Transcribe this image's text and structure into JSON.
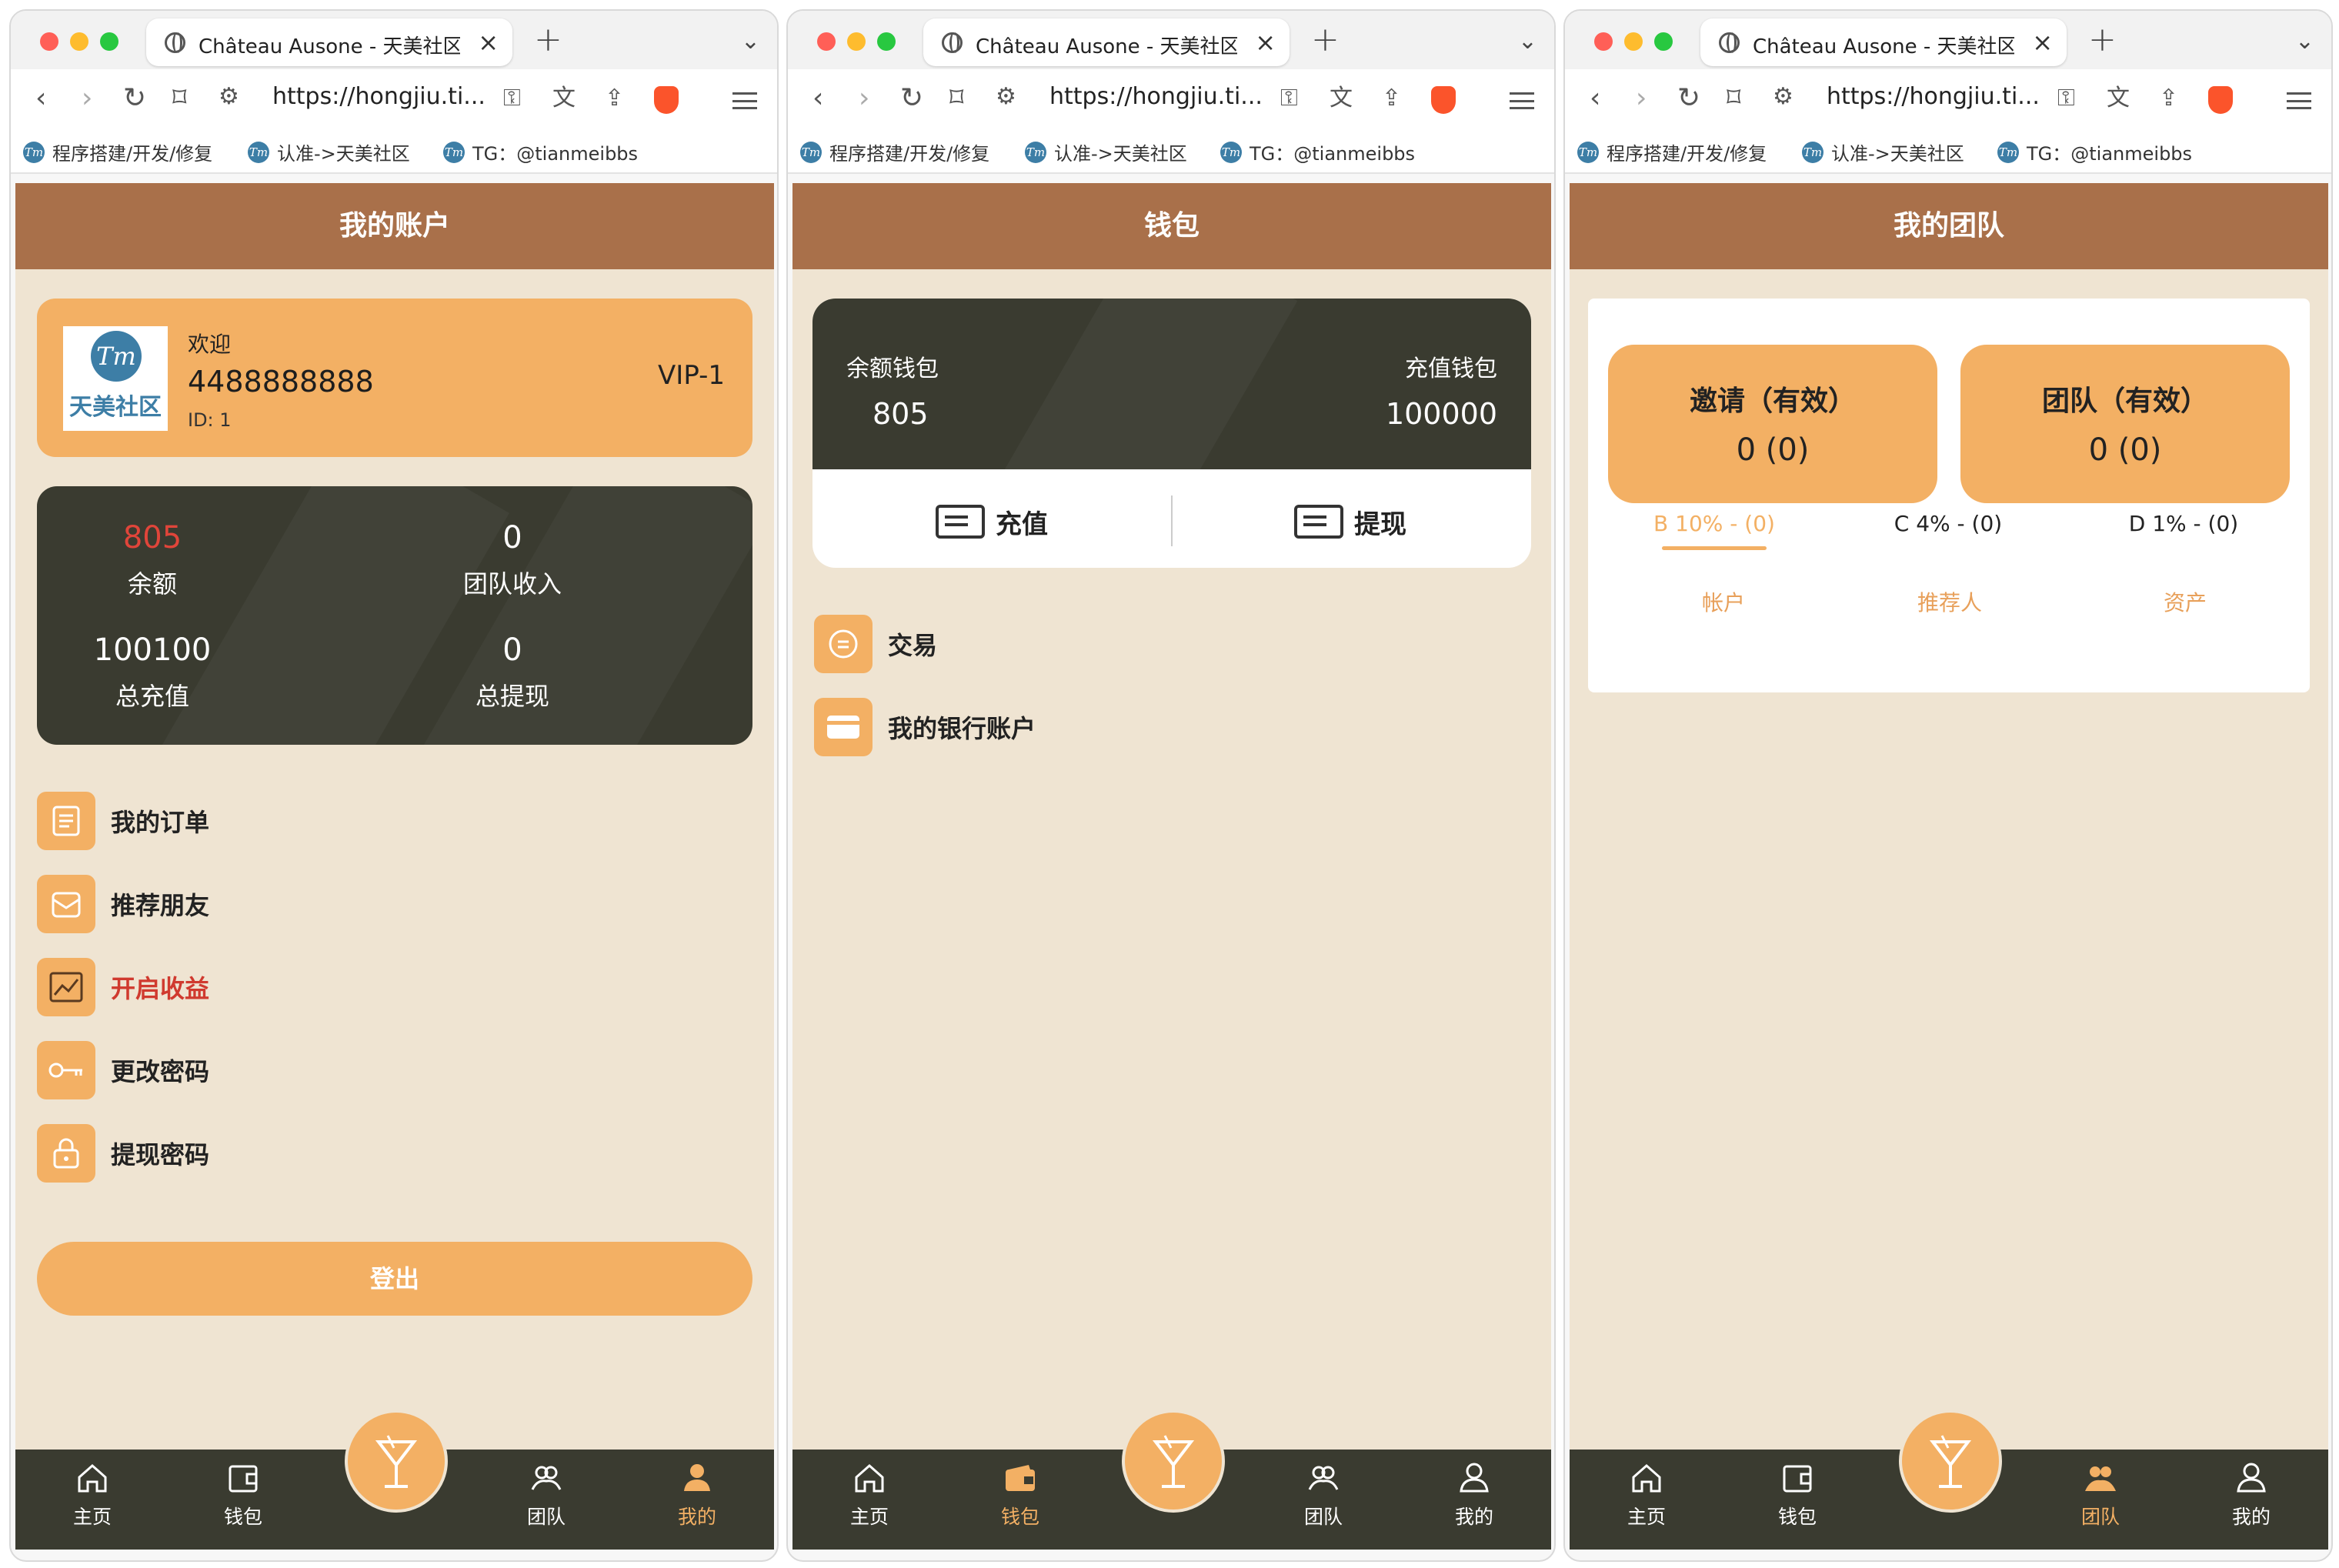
{
  "browser": {
    "tab_title": "Château Ausone - 天美社区tianmeibbs",
    "url": "https://hongjiu.ti...",
    "bookmarks": [
      "程序搭建/开发/修复",
      "认准->天美社区",
      "TG：@tianmeibbs"
    ]
  },
  "colors": {
    "accent": "#f3b064",
    "header": "#a9704a",
    "dark": "#3a3b30",
    "bg": "#efe4d2"
  },
  "nav": {
    "home": "主页",
    "wallet": "钱包",
    "team": "团队",
    "mine": "我的"
  },
  "account": {
    "title": "我的账户",
    "welcome": "欢迎",
    "username": "4488888888",
    "id": "ID: 1",
    "vip": "VIP-1",
    "logo_text": "天美社区",
    "stats": [
      {
        "value": "805",
        "label": "余额"
      },
      {
        "value": "0",
        "label": "团队收入"
      },
      {
        "value": "100100",
        "label": "总充值"
      },
      {
        "value": "0",
        "label": "总提现"
      }
    ],
    "menu": [
      {
        "label": "我的订单",
        "icon": "order-icon"
      },
      {
        "label": "推荐朋友",
        "icon": "refer-icon"
      },
      {
        "label": "开启收益",
        "icon": "earnings-chart-icon"
      },
      {
        "label": "更改密码",
        "icon": "key-icon"
      },
      {
        "label": "提现密码",
        "icon": "lock-icon"
      }
    ],
    "logout": "登出"
  },
  "wallet": {
    "title": "钱包",
    "balance_label": "余额钱包",
    "balance_value": "805",
    "recharge_wallet_label": "充值钱包",
    "recharge_wallet_value": "100000",
    "recharge_btn": "充值",
    "withdraw_btn": "提现",
    "menu": [
      {
        "label": "交易",
        "icon": "transaction-icon"
      },
      {
        "label": "我的银行账户",
        "icon": "bank-card-icon"
      }
    ]
  },
  "team": {
    "title": "我的团队",
    "invite_label": "邀请（有效）",
    "invite_value": "0 (0)",
    "team_label": "团队（有效）",
    "team_value": "0 (0)",
    "levels": [
      "B 10% - (0)",
      "C 4% - (0)",
      "D 1% - (0)"
    ],
    "subtabs": [
      "帐户",
      "推荐人",
      "资产"
    ]
  }
}
